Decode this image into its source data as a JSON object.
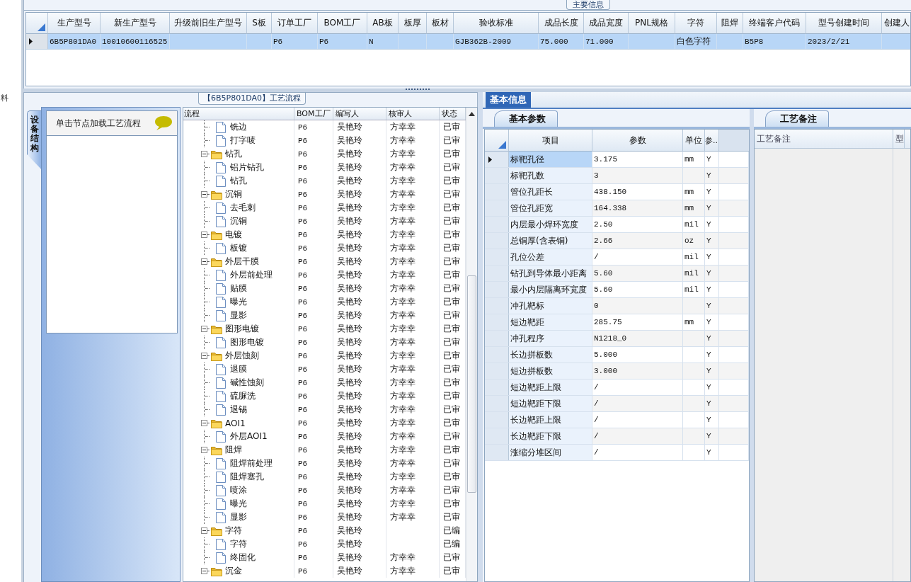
{
  "side_strip": {
    "text": "料"
  },
  "main_info": {
    "title": "主要信息",
    "columns": [
      "生产型号",
      "新生产型号",
      "升级前旧生产型号",
      "S板",
      "订单工厂",
      "BOM工厂",
      "AB板",
      "板厚",
      "板材",
      "验收标准",
      "成品长度",
      "成品宽度",
      "PNL规格",
      "字符",
      "阻焊",
      "终端客户代码",
      "型号创建时间",
      "创建人"
    ],
    "rows": [
      {
        "selected": true,
        "cells": [
          "6B5P801DA0",
          "10010600116525",
          "",
          "",
          "P6",
          "P6",
          "N",
          "",
          "",
          "GJB362B-2009",
          "75.000",
          "71.000",
          "",
          "白色字符",
          "",
          "B5P8",
          "2023/2/21",
          ""
        ]
      }
    ]
  },
  "process": {
    "title": "【6B5P801DA0】工艺流程",
    "side_tab": "设备结构",
    "hint": "单击节点加载工艺流程",
    "columns": [
      "流程",
      "BOM工厂",
      "编写人",
      "核审人",
      "状态"
    ],
    "nodes": [
      {
        "children": [
          {
            "label": "铣边",
            "bom": "P6",
            "writer": "吴艳玲",
            "reviewer": "方幸幸",
            "status": "已审"
          },
          {
            "label": "打字唛",
            "bom": "P6",
            "writer": "吴艳玲",
            "reviewer": "方幸幸",
            "status": "已审"
          }
        ]
      },
      {
        "label": "钻孔",
        "bom": "P6",
        "writer": "吴艳玲",
        "reviewer": "方幸幸",
        "status": "已审",
        "expanded": true,
        "children": [
          {
            "label": "铝片钻孔",
            "bom": "P6",
            "writer": "吴艳玲",
            "reviewer": "方幸幸",
            "status": "已审"
          },
          {
            "label": "钻孔",
            "bom": "P6",
            "writer": "吴艳玲",
            "reviewer": "方幸幸",
            "status": "已审"
          }
        ]
      },
      {
        "label": "沉铜",
        "bom": "P6",
        "writer": "吴艳玲",
        "reviewer": "方幸幸",
        "status": "已审",
        "expanded": true,
        "children": [
          {
            "label": "去毛刺",
            "bom": "P6",
            "writer": "吴艳玲",
            "reviewer": "方幸幸",
            "status": "已审"
          },
          {
            "label": "沉铜",
            "bom": "P6",
            "writer": "吴艳玲",
            "reviewer": "方幸幸",
            "status": "已审"
          }
        ]
      },
      {
        "label": "电镀",
        "bom": "P6",
        "writer": "吴艳玲",
        "reviewer": "方幸幸",
        "status": "已审",
        "expanded": true,
        "children": [
          {
            "label": "板镀",
            "bom": "P6",
            "writer": "吴艳玲",
            "reviewer": "方幸幸",
            "status": "已审"
          }
        ]
      },
      {
        "label": "外层干膜",
        "bom": "P6",
        "writer": "吴艳玲",
        "reviewer": "方幸幸",
        "status": "已审",
        "expanded": true,
        "children": [
          {
            "label": "外层前处理",
            "bom": "P6",
            "writer": "吴艳玲",
            "reviewer": "方幸幸",
            "status": "已审"
          },
          {
            "label": "贴膜",
            "bom": "P6",
            "writer": "吴艳玲",
            "reviewer": "方幸幸",
            "status": "已审"
          },
          {
            "label": "曝光",
            "bom": "P6",
            "writer": "吴艳玲",
            "reviewer": "方幸幸",
            "status": "已审"
          },
          {
            "label": "显影",
            "bom": "P6",
            "writer": "吴艳玲",
            "reviewer": "方幸幸",
            "status": "已审"
          }
        ]
      },
      {
        "label": "图形电镀",
        "bom": "P6",
        "writer": "吴艳玲",
        "reviewer": "方幸幸",
        "status": "已审",
        "expanded": true,
        "children": [
          {
            "label": "图形电镀",
            "bom": "P6",
            "writer": "吴艳玲",
            "reviewer": "方幸幸",
            "status": "已审"
          }
        ]
      },
      {
        "label": "外层蚀刻",
        "bom": "P6",
        "writer": "吴艳玲",
        "reviewer": "方幸幸",
        "status": "已审",
        "expanded": true,
        "children": [
          {
            "label": "退膜",
            "bom": "P6",
            "writer": "吴艳玲",
            "reviewer": "方幸幸",
            "status": "已审"
          },
          {
            "label": "碱性蚀刻",
            "bom": "P6",
            "writer": "吴艳玲",
            "reviewer": "方幸幸",
            "status": "已审"
          },
          {
            "label": "硫脲洗",
            "bom": "P6",
            "writer": "吴艳玲",
            "reviewer": "方幸幸",
            "status": "已审"
          },
          {
            "label": "退锡",
            "bom": "P6",
            "writer": "吴艳玲",
            "reviewer": "方幸幸",
            "status": "已审"
          }
        ]
      },
      {
        "label": "AOI1",
        "bom": "P6",
        "writer": "吴艳玲",
        "reviewer": "方幸幸",
        "status": "已审",
        "expanded": true,
        "children": [
          {
            "label": "外层AOI1",
            "bom": "P6",
            "writer": "吴艳玲",
            "reviewer": "方幸幸",
            "status": "已审"
          }
        ]
      },
      {
        "label": "阻焊",
        "bom": "P6",
        "writer": "吴艳玲",
        "reviewer": "方幸幸",
        "status": "已审",
        "expanded": true,
        "children": [
          {
            "label": "阻焊前处理",
            "bom": "P6",
            "writer": "吴艳玲",
            "reviewer": "方幸幸",
            "status": "已审"
          },
          {
            "label": "阻焊塞孔",
            "bom": "P6",
            "writer": "吴艳玲",
            "reviewer": "方幸幸",
            "status": "已审"
          },
          {
            "label": "喷涂",
            "bom": "P6",
            "writer": "吴艳玲",
            "reviewer": "方幸幸",
            "status": "已审"
          },
          {
            "label": "曝光",
            "bom": "P6",
            "writer": "吴艳玲",
            "reviewer": "方幸幸",
            "status": "已审"
          },
          {
            "label": "显影",
            "bom": "P6",
            "writer": "吴艳玲",
            "reviewer": "方幸幸",
            "status": "已审"
          }
        ]
      },
      {
        "label": "字符",
        "bom": "P6",
        "writer": "吴艳玲",
        "status": "已编",
        "expanded": true,
        "children": [
          {
            "label": "字符",
            "bom": "P6",
            "writer": "吴艳玲",
            "status": "已编"
          },
          {
            "label": "终固化",
            "bom": "P6",
            "writer": "吴艳玲",
            "reviewer": "方幸幸",
            "status": "已审"
          }
        ]
      },
      {
        "label": "沉金",
        "bom": "P6",
        "writer": "吴艳玲",
        "reviewer": "方幸幸",
        "status": "已审",
        "expanded": true
      }
    ]
  },
  "detail": {
    "tabs": [
      {
        "label": "基本信息",
        "selected": true
      }
    ],
    "params": {
      "tab": "基本参数",
      "columns": [
        "项目",
        "参数",
        "单位",
        "参.."
      ],
      "rows": [
        {
          "item": "标靶孔径",
          "value": "3.175",
          "unit": "mm",
          "flag": "Y",
          "selected": true
        },
        {
          "item": "标靶孔数",
          "value": "3",
          "unit": "",
          "flag": "Y",
          "selected": false
        },
        {
          "item": "管位孔距长",
          "value": "438.150",
          "unit": "mm",
          "flag": "Y",
          "selected": false
        },
        {
          "item": "管位孔距宽",
          "value": "164.338",
          "unit": "mm",
          "flag": "Y",
          "selected": false
        },
        {
          "item": "内层最小焊环宽度",
          "value": "2.50",
          "unit": "mil",
          "flag": "Y",
          "selected": false
        },
        {
          "item": "总铜厚(含表铜)",
          "value": "2.66",
          "unit": "oz",
          "flag": "Y",
          "selected": false
        },
        {
          "item": "孔位公差",
          "value": "/",
          "unit": "mil",
          "flag": "Y",
          "selected": false
        },
        {
          "item": "钻孔到导体最小距离",
          "value": "5.60",
          "unit": "mil",
          "flag": "Y",
          "selected": false
        },
        {
          "item": "最小内层隔离环宽度",
          "value": "5.60",
          "unit": "mil",
          "flag": "Y",
          "selected": false
        },
        {
          "item": "冲孔靶标",
          "value": "0",
          "unit": "",
          "flag": "Y",
          "selected": false
        },
        {
          "item": "短边靶距",
          "value": "285.75",
          "unit": "mm",
          "flag": "Y",
          "selected": false
        },
        {
          "item": "冲孔程序",
          "value": "N1218_0",
          "unit": "",
          "flag": "Y",
          "selected": false
        },
        {
          "item": "长边拼板数",
          "value": "5.000",
          "unit": "",
          "flag": "Y",
          "selected": false
        },
        {
          "item": "短边拼板数",
          "value": "3.000",
          "unit": "",
          "flag": "Y",
          "selected": false
        },
        {
          "item": "短边靶距上限",
          "value": "/",
          "unit": "",
          "flag": "Y",
          "selected": false
        },
        {
          "item": "短边靶距下限",
          "value": "/",
          "unit": "",
          "flag": "Y",
          "selected": false
        },
        {
          "item": "长边靶距上限",
          "value": "/",
          "unit": "",
          "flag": "Y",
          "selected": false
        },
        {
          "item": "长边靶距下限",
          "value": "/",
          "unit": "",
          "flag": "Y",
          "selected": false
        },
        {
          "item": "涨缩分堆区间",
          "value": "/",
          "unit": "",
          "flag": "Y",
          "selected": false
        }
      ]
    },
    "notes": {
      "tab": "工艺备注",
      "columns": [
        "工艺备注",
        "型"
      ]
    }
  }
}
